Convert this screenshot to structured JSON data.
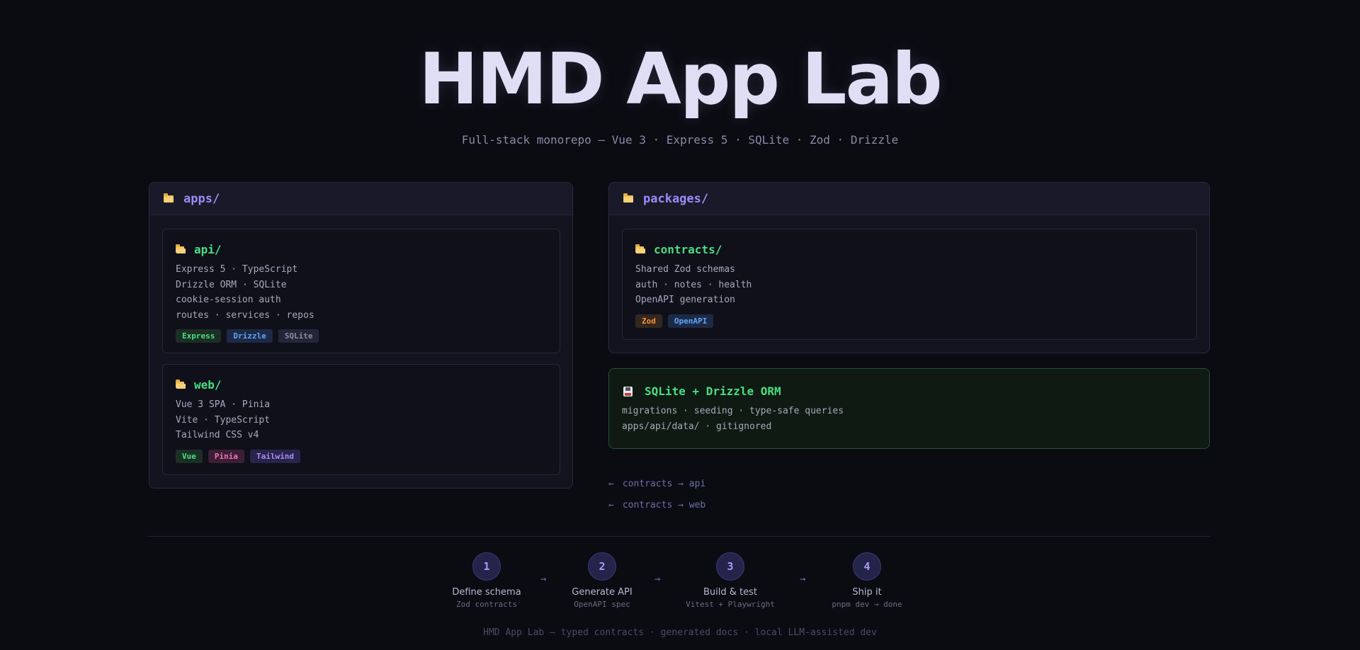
{
  "hero": {
    "title": "HMD App Lab",
    "subtitle": "Full-stack monorepo — Vue 3 · Express 5 · SQLite · Zod · Drizzle"
  },
  "apps_panel": {
    "title": "apps/",
    "cards": [
      {
        "title": "api/",
        "lines": [
          "Express 5 · TypeScript",
          "Drizzle ORM · SQLite",
          "cookie-session auth",
          "routes · services · repos"
        ],
        "tags": [
          {
            "label": "Express",
            "color": "#4ade80",
            "bg": "#1b2f25"
          },
          {
            "label": "Drizzle",
            "color": "#60a5fa",
            "bg": "#1d2a45"
          },
          {
            "label": "SQLite",
            "color": "#8a8aa0",
            "bg": "#25253a"
          }
        ]
      },
      {
        "title": "web/",
        "lines": [
          "Vue 3 SPA · Pinia",
          "Vite · TypeScript",
          "Tailwind CSS v4"
        ],
        "tags": [
          {
            "label": "Vue",
            "color": "#4ade80",
            "bg": "#1b2f25"
          },
          {
            "label": "Pinia",
            "color": "#f472b6",
            "bg": "#3a1f35"
          },
          {
            "label": "Tailwind",
            "color": "#a78bfa",
            "bg": "#28244a"
          }
        ]
      }
    ]
  },
  "packages_panel": {
    "title": "packages/",
    "cards": [
      {
        "title": "contracts/",
        "lines": [
          "Shared Zod schemas",
          "auth · notes · health",
          "OpenAPI generation"
        ],
        "tags": [
          {
            "label": "Zod",
            "color": "#fb923c",
            "bg": "#33271f"
          },
          {
            "label": "OpenAPI",
            "color": "#60a5fa",
            "bg": "#1d2a45"
          }
        ]
      }
    ]
  },
  "database": {
    "icon": "floppy-disk-icon",
    "title": "SQLite + Drizzle ORM",
    "lines": [
      "migrations · seeding · type-safe queries",
      "apps/api/data/ · gitignored"
    ]
  },
  "flows": [
    {
      "text": "contracts → api",
      "icon": "arrow-left-icon"
    },
    {
      "text": "contracts → web",
      "icon": "arrow-left-icon"
    }
  ],
  "steps": [
    {
      "number": "1",
      "title": "Define schema",
      "subtitle": "Zod contracts"
    },
    {
      "number": "2",
      "title": "Generate API",
      "subtitle": "OpenAPI spec"
    },
    {
      "number": "3",
      "title": "Build & test",
      "subtitle": "Vitest + Playwright"
    },
    {
      "number": "4",
      "title": "Ship it",
      "subtitle": "pnpm dev → done"
    }
  ],
  "step_arrow": "→",
  "footer": "HMD App Lab — typed contracts · generated docs · local LLM-assisted dev"
}
